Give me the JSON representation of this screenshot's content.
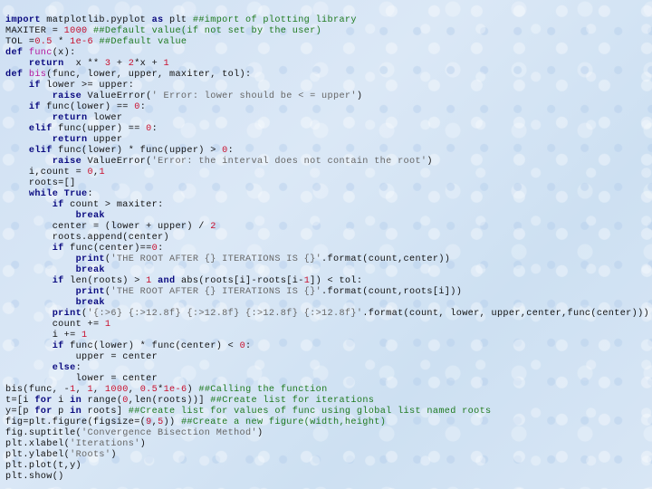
{
  "slide": {
    "background": "light-blue textured paper",
    "colors": {
      "keyword": "#0a0a80",
      "number": "#c8102e",
      "comment": "#1f7a1f",
      "string": "#666666",
      "function_name": "#b5179e",
      "text": "#111111"
    },
    "code_lines": [
      {
        "indent": 0,
        "tokens": [
          [
            "kw",
            "import"
          ],
          [
            "tx",
            " matplotlib.pyplot "
          ],
          [
            "kw",
            "as"
          ],
          [
            "tx",
            " plt "
          ],
          [
            "cm",
            "##import of plotting library"
          ]
        ]
      },
      {
        "indent": 0,
        "tokens": [
          [
            "tx",
            "MAXITER = "
          ],
          [
            "num",
            "1000"
          ],
          [
            "tx",
            " "
          ],
          [
            "cm",
            "##Default value(if not set by the user)"
          ]
        ]
      },
      {
        "indent": 0,
        "tokens": [
          [
            "tx",
            "TOL ="
          ],
          [
            "num",
            "0.5"
          ],
          [
            "tx",
            " * "
          ],
          [
            "num",
            "1e-6"
          ],
          [
            "tx",
            " "
          ],
          [
            "cm",
            "##Default value"
          ]
        ]
      },
      {
        "indent": 0,
        "tokens": [
          [
            "kw",
            "def"
          ],
          [
            "tx",
            " "
          ],
          [
            "fn",
            "func"
          ],
          [
            "tx",
            "(x):"
          ]
        ]
      },
      {
        "indent": 1,
        "tokens": [
          [
            "kw",
            "return"
          ],
          [
            "tx",
            "  x ** "
          ],
          [
            "num",
            "3"
          ],
          [
            "tx",
            " + "
          ],
          [
            "num",
            "2"
          ],
          [
            "tx",
            "*x + "
          ],
          [
            "num",
            "1"
          ]
        ]
      },
      {
        "indent": 0,
        "tokens": [
          [
            "kw",
            "def"
          ],
          [
            "tx",
            " "
          ],
          [
            "fn",
            "bis"
          ],
          [
            "tx",
            "(func, lower, upper, maxiter, tol):"
          ]
        ]
      },
      {
        "indent": 1,
        "tokens": [
          [
            "kw",
            "if"
          ],
          [
            "tx",
            " lower >= upper:"
          ]
        ]
      },
      {
        "indent": 2,
        "tokens": [
          [
            "kw",
            "raise"
          ],
          [
            "tx",
            " ValueError("
          ],
          [
            "str",
            "' Error: lower should be < = upper'"
          ],
          [
            "tx",
            ")"
          ]
        ]
      },
      {
        "indent": 1,
        "tokens": [
          [
            "kw",
            "if"
          ],
          [
            "tx",
            " func(lower) == "
          ],
          [
            "num",
            "0"
          ],
          [
            "tx",
            ":"
          ]
        ]
      },
      {
        "indent": 2,
        "tokens": [
          [
            "kw",
            "return"
          ],
          [
            "tx",
            " lower"
          ]
        ]
      },
      {
        "indent": 1,
        "tokens": [
          [
            "kw",
            "elif"
          ],
          [
            "tx",
            " func(upper) == "
          ],
          [
            "num",
            "0"
          ],
          [
            "tx",
            ":"
          ]
        ]
      },
      {
        "indent": 2,
        "tokens": [
          [
            "kw",
            "return"
          ],
          [
            "tx",
            " upper"
          ]
        ]
      },
      {
        "indent": 1,
        "tokens": [
          [
            "kw",
            "elif"
          ],
          [
            "tx",
            " func(lower) * func(upper) > "
          ],
          [
            "num",
            "0"
          ],
          [
            "tx",
            ":"
          ]
        ]
      },
      {
        "indent": 2,
        "tokens": [
          [
            "kw",
            "raise"
          ],
          [
            "tx",
            " ValueError("
          ],
          [
            "str",
            "'Error: the interval does not contain the root'"
          ],
          [
            "tx",
            ")"
          ]
        ]
      },
      {
        "indent": 1,
        "tokens": [
          [
            "tx",
            "i,count = "
          ],
          [
            "num",
            "0"
          ],
          [
            "tx",
            ","
          ],
          [
            "num",
            "1"
          ]
        ]
      },
      {
        "indent": 1,
        "tokens": [
          [
            "tx",
            "roots=[]"
          ]
        ]
      },
      {
        "indent": 1,
        "tokens": [
          [
            "kw",
            "while"
          ],
          [
            "tx",
            " "
          ],
          [
            "kw",
            "True"
          ],
          [
            "tx",
            ":"
          ]
        ]
      },
      {
        "indent": 2,
        "tokens": [
          [
            "kw",
            "if"
          ],
          [
            "tx",
            " count > maxiter:"
          ]
        ]
      },
      {
        "indent": 3,
        "tokens": [
          [
            "kw",
            "break"
          ]
        ]
      },
      {
        "indent": 2,
        "tokens": [
          [
            "tx",
            "center = (lower + upper) / "
          ],
          [
            "num",
            "2"
          ]
        ]
      },
      {
        "indent": 2,
        "tokens": [
          [
            "tx",
            "roots.append(center)"
          ]
        ]
      },
      {
        "indent": 2,
        "tokens": [
          [
            "kw",
            "if"
          ],
          [
            "tx",
            " func(center)=="
          ],
          [
            "num",
            "0"
          ],
          [
            "tx",
            ":"
          ]
        ]
      },
      {
        "indent": 3,
        "tokens": [
          [
            "kw",
            "print"
          ],
          [
            "tx",
            "("
          ],
          [
            "str",
            "'THE ROOT AFTER {} ITERATIONS IS {}'"
          ],
          [
            "tx",
            ".format(count,center))"
          ]
        ]
      },
      {
        "indent": 3,
        "tokens": [
          [
            "kw",
            "break"
          ]
        ]
      },
      {
        "indent": 2,
        "tokens": [
          [
            "kw",
            "if"
          ],
          [
            "tx",
            " len(roots) > "
          ],
          [
            "num",
            "1"
          ],
          [
            "tx",
            " "
          ],
          [
            "kw",
            "and"
          ],
          [
            "tx",
            " abs(roots[i]-roots[i-"
          ],
          [
            "num",
            "1"
          ],
          [
            "tx",
            "]) < tol:"
          ]
        ]
      },
      {
        "indent": 3,
        "tokens": [
          [
            "kw",
            "print"
          ],
          [
            "tx",
            "("
          ],
          [
            "str",
            "'THE ROOT AFTER {} ITERATIONS IS {}'"
          ],
          [
            "tx",
            ".format(count,roots[i]))"
          ]
        ]
      },
      {
        "indent": 3,
        "tokens": [
          [
            "kw",
            "break"
          ]
        ]
      },
      {
        "indent": 2,
        "tokens": [
          [
            "kw",
            "print"
          ],
          [
            "tx",
            "("
          ],
          [
            "str",
            "'{:>6} {:>12.8f} {:>12.8f} {:>12.8f} {:>12.8f}'"
          ],
          [
            "tx",
            ".format(count, lower, upper,center,func(center)))"
          ]
        ]
      },
      {
        "indent": 2,
        "tokens": [
          [
            "tx",
            "count += "
          ],
          [
            "num",
            "1"
          ]
        ]
      },
      {
        "indent": 2,
        "tokens": [
          [
            "tx",
            "i += "
          ],
          [
            "num",
            "1"
          ]
        ]
      },
      {
        "indent": 2,
        "tokens": [
          [
            "kw",
            "if"
          ],
          [
            "tx",
            " func(lower) * func(center) < "
          ],
          [
            "num",
            "0"
          ],
          [
            "tx",
            ":"
          ]
        ]
      },
      {
        "indent": 3,
        "tokens": [
          [
            "tx",
            "upper = center"
          ]
        ]
      },
      {
        "indent": 2,
        "tokens": [
          [
            "kw",
            "else"
          ],
          [
            "tx",
            ":"
          ]
        ]
      },
      {
        "indent": 3,
        "tokens": [
          [
            "tx",
            "lower = center"
          ]
        ]
      },
      {
        "indent": 0,
        "tokens": [
          [
            "tx",
            "bis(func, -"
          ],
          [
            "num",
            "1"
          ],
          [
            "tx",
            ", "
          ],
          [
            "num",
            "1"
          ],
          [
            "tx",
            ", "
          ],
          [
            "num",
            "1000"
          ],
          [
            "tx",
            ", "
          ],
          [
            "num",
            "0.5"
          ],
          [
            "tx",
            "*"
          ],
          [
            "num",
            "1e-6"
          ],
          [
            "tx",
            ") "
          ],
          [
            "cm",
            "##Calling the function"
          ]
        ]
      },
      {
        "indent": 0,
        "tokens": [
          [
            "tx",
            "t=[i "
          ],
          [
            "kw",
            "for"
          ],
          [
            "tx",
            " i "
          ],
          [
            "kw",
            "in"
          ],
          [
            "tx",
            " range("
          ],
          [
            "num",
            "0"
          ],
          [
            "tx",
            ",len(roots))] "
          ],
          [
            "cm",
            "##Create list for iterations"
          ]
        ]
      },
      {
        "indent": 0,
        "tokens": [
          [
            "tx",
            "y=[p "
          ],
          [
            "kw",
            "for"
          ],
          [
            "tx",
            " p "
          ],
          [
            "kw",
            "in"
          ],
          [
            "tx",
            " roots] "
          ],
          [
            "cm",
            "##Create list for values of func using global list named roots"
          ]
        ]
      },
      {
        "indent": 0,
        "tokens": [
          [
            "tx",
            "fig=plt.figure(figsize=("
          ],
          [
            "num",
            "9"
          ],
          [
            "tx",
            ","
          ],
          [
            "num",
            "5"
          ],
          [
            "tx",
            "))"
          ],
          [
            "tx",
            " "
          ],
          [
            "cm",
            "##Create a new figure(width,height)"
          ]
        ]
      },
      {
        "indent": 0,
        "tokens": [
          [
            "tx",
            "fig.suptitle("
          ],
          [
            "str",
            "'Convergence Bisection Method'"
          ],
          [
            "tx",
            ")"
          ]
        ]
      },
      {
        "indent": 0,
        "tokens": [
          [
            "tx",
            "plt.xlabel("
          ],
          [
            "str",
            "'Iterations'"
          ],
          [
            "tx",
            ")"
          ]
        ]
      },
      {
        "indent": 0,
        "tokens": [
          [
            "tx",
            "plt.ylabel("
          ],
          [
            "str",
            "'Roots'"
          ],
          [
            "tx",
            ")"
          ]
        ]
      },
      {
        "indent": 0,
        "tokens": [
          [
            "tx",
            "plt.plot(t,y)"
          ]
        ]
      },
      {
        "indent": 0,
        "tokens": [
          [
            "tx",
            "plt.show()"
          ]
        ]
      }
    ]
  }
}
